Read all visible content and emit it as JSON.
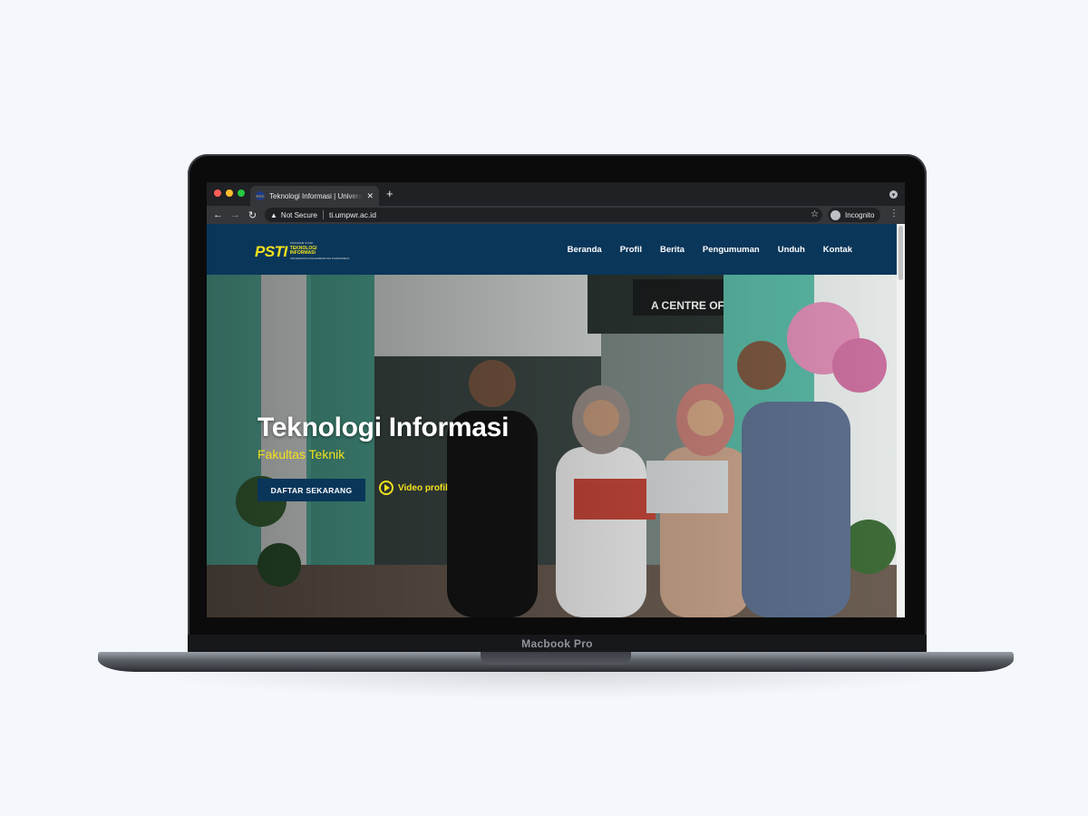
{
  "device": {
    "label": "Macbook Pro"
  },
  "browser": {
    "tab_title": "Teknologi Informasi | Universitas Muhammadiyah Purworejo",
    "favicon_text": "PSTI",
    "security_label": "Not Secure",
    "url": "ti.umpwr.ac.id",
    "profile_label": "Incognito",
    "icons": [
      "back-icon",
      "forward-icon",
      "reload-icon",
      "warning-icon",
      "star-icon",
      "incognito-icon",
      "kebab-menu-icon",
      "new-tab-icon",
      "close-tab-icon"
    ]
  },
  "site": {
    "logo": {
      "mark": "PSTI",
      "line1": "PROGRAM STUDI",
      "line2": "TEKNOLOGI",
      "line3": "INFORMASI",
      "line4": "UNIVERSITAS MUHAMMADIYAH PURWOREJO"
    },
    "nav": [
      "Beranda",
      "Profil",
      "Berita",
      "Pengumuman",
      "Unduh",
      "Kontak"
    ],
    "hero": {
      "title": "Teknologi Informasi",
      "subtitle": "Fakultas Teknik",
      "cta_label": "DAFTAR SEKARANG",
      "video_label": "Video profil"
    },
    "colors": {
      "primary": "#0a365a",
      "accent": "#f3e11c"
    }
  }
}
